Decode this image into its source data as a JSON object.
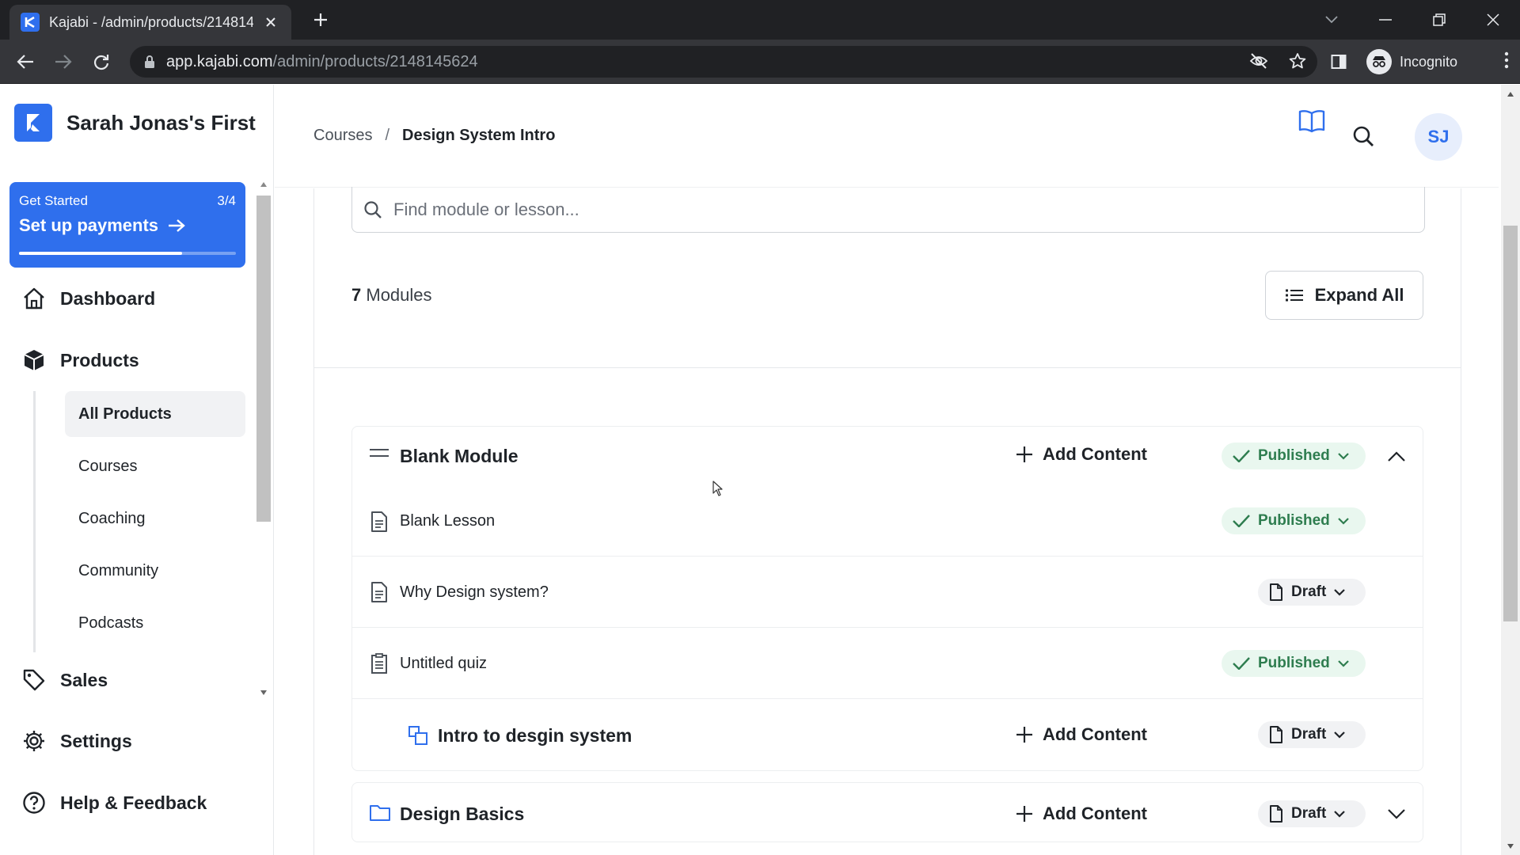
{
  "browser": {
    "tab_title": "Kajabi - /admin/products/2148145624",
    "url_host": "app.kajabi.com",
    "url_path": "/admin/products/2148145624",
    "profile_label": "Incognito"
  },
  "sidebar": {
    "brand_name": "Sarah Jonas's First",
    "get_started": {
      "label": "Get Started",
      "progress_text": "3/4",
      "progress_fraction": 0.75,
      "title": "Set up payments"
    },
    "nav": {
      "dashboard": "Dashboard",
      "products": "Products",
      "sales": "Sales",
      "settings": "Settings",
      "help": "Help & Feedback"
    },
    "product_items": [
      "All Products",
      "Courses",
      "Coaching",
      "Community",
      "Podcasts"
    ]
  },
  "header": {
    "breadcrumb_parent": "Courses",
    "breadcrumb_separator": "/",
    "breadcrumb_current": "Design System Intro",
    "avatar_initials": "SJ"
  },
  "main": {
    "search_placeholder": "Find module or lesson...",
    "module_count": "7",
    "module_count_label": "Modules",
    "expand_all_label": "Expand All",
    "add_content_label": "Add Content",
    "modules": [
      {
        "title": "Blank Module",
        "status": "Published",
        "expanded": true,
        "items": [
          {
            "title": "Blank Lesson",
            "status": "Published",
            "icon": "document-icon"
          },
          {
            "title": "Why Design system?",
            "status": "Draft",
            "icon": "document-icon"
          },
          {
            "title": "Untitled quiz",
            "status": "Published",
            "icon": "quiz-icon"
          }
        ],
        "submodule": {
          "title": "Intro to desgin system",
          "status": "Draft"
        }
      },
      {
        "title": "Design Basics",
        "status": "Draft",
        "expanded": false
      }
    ]
  },
  "colors": {
    "brand_blue": "#2f6fed",
    "published_green": "#2e7d4f",
    "published_bg": "#e9f7ef"
  }
}
